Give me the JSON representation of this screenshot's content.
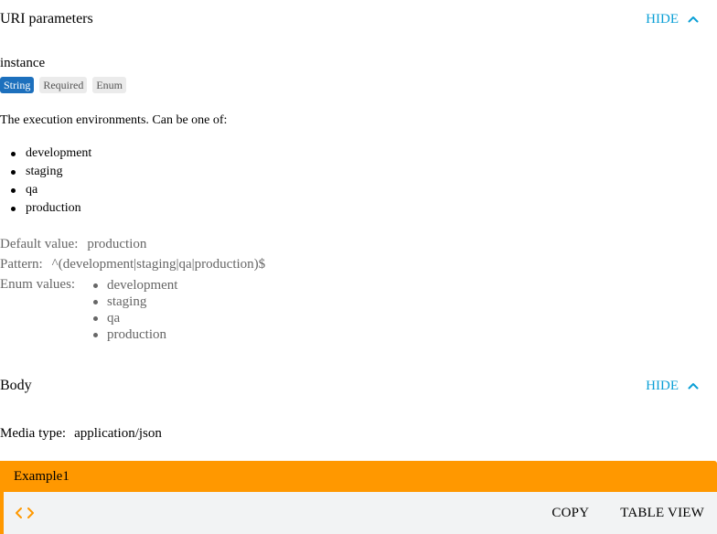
{
  "uri_section": {
    "title": "URI parameters",
    "toggle_label": "HIDE"
  },
  "param": {
    "name": "instance",
    "badges": [
      "String",
      "Required",
      "Enum"
    ],
    "description": "The execution environments. Can be one of:",
    "description_items": [
      "development",
      "staging",
      "qa",
      "production"
    ],
    "default_label": "Default value:",
    "default_value": "production",
    "pattern_label": "Pattern:",
    "pattern_value": "^(development|staging|qa|production)$",
    "enum_label": "Enum values:",
    "enum_values": [
      "development",
      "staging",
      "qa",
      "production"
    ]
  },
  "body_section": {
    "title": "Body",
    "toggle_label": "HIDE",
    "media_label": "Media type:",
    "media_value": "application/json"
  },
  "example": {
    "title": "Example1",
    "copy_label": "COPY",
    "table_view_label": "TABLE VIEW",
    "code_icon": "code-brackets-icon"
  },
  "colors": {
    "accent": "#0a9fd6",
    "example_bar": "#ff9800",
    "badge_primary": "#1d70bd"
  }
}
